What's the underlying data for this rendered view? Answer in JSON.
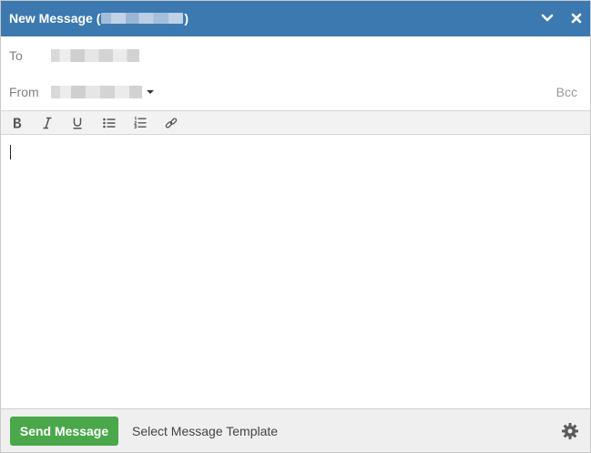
{
  "header": {
    "title_prefix": "New Message (",
    "title_suffix": ")",
    "minimize_icon": "chevron-down-icon",
    "close_icon": "close-icon",
    "background": "#3d79b1"
  },
  "fields": {
    "to_label": "To",
    "from_label": "From",
    "bcc_label": "Bcc"
  },
  "toolbar": {
    "buttons": [
      "bold-icon",
      "italic-icon",
      "underline-icon",
      "bullet-list-icon",
      "numbered-list-icon",
      "link-icon"
    ]
  },
  "footer": {
    "send_label": "Send Message",
    "template_label": "Select Message Template",
    "settings_icon": "gear-icon",
    "send_color": "#4aa84b"
  }
}
